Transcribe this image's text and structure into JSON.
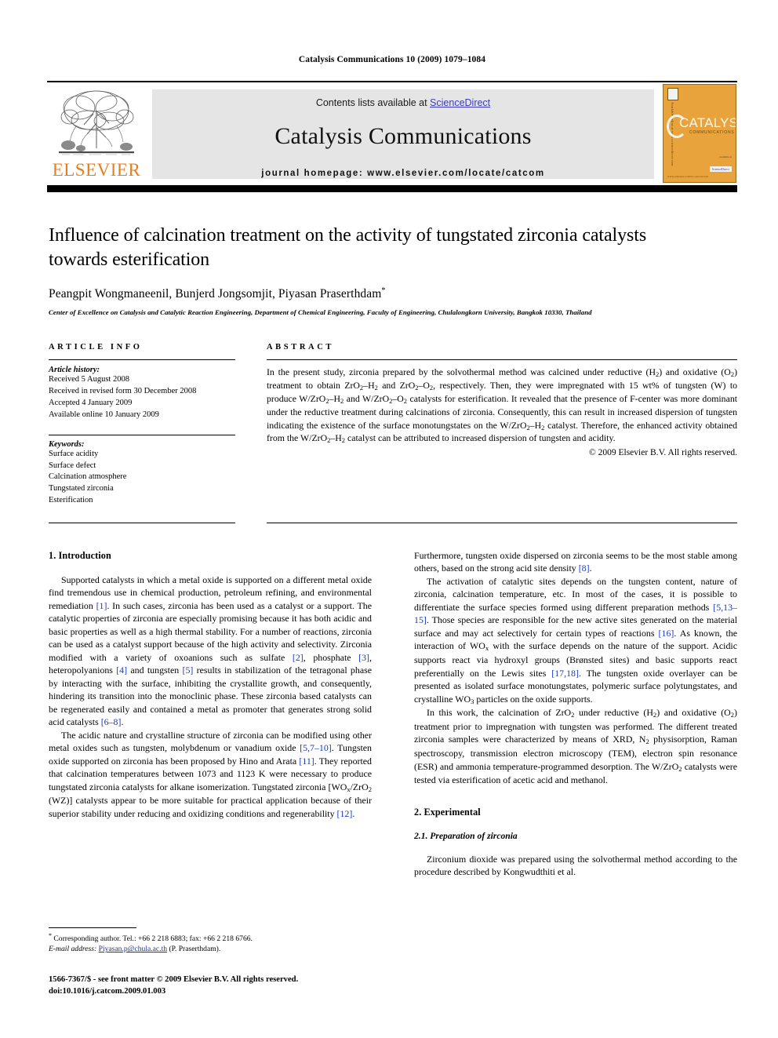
{
  "running_head": "Catalysis Communications 10 (2009) 1079–1084",
  "masthead": {
    "contents_prefix": "Contents lists available at ",
    "sciencedirect": "ScienceDirect",
    "journal_title": "Catalysis Communications",
    "homepage": "journal homepage: www.elsevier.com/locate/catcom",
    "publisher_wordmark": "ELSEVIER",
    "publisher_color": "#E87D1E",
    "link_color": "#3b3bbf",
    "panel_color": "#E5E5E5",
    "cover": {
      "title": "CATALYSIS",
      "subtitle": "COMMUNICATIONS",
      "bg_color": "#E8A33D",
      "vertical_text": "Available online at www.sciencedirect.com",
      "bottom_left": "www.elsevier.com/locate/catcom",
      "sd_above": "available at",
      "sd_badge": "ScienceDirect"
    }
  },
  "article": {
    "title": "Influence of calcination treatment on the activity of tungstated zirconia catalysts towards esterification",
    "authors": "Peangpit Wongmaneenil, Bunjerd Jongsomjit, Piyasan Praserthdam",
    "corresponding_marker": "*",
    "affiliation": "Center of Excellence on Catalysis and Catalytic Reaction Engineering, Department of Chemical Engineering, Faculty of Engineering, Chulalongkorn University, Bangkok 10330, Thailand"
  },
  "article_info": {
    "heading": "ARTICLE INFO",
    "history_label": "Article history:",
    "history": [
      "Received 5 August 2008",
      "Received in revised form 30 December 2008",
      "Accepted 4 January 2009",
      "Available online 10 January 2009"
    ],
    "keywords_label": "Keywords:",
    "keywords": [
      "Surface acidity",
      "Surface defect",
      "Calcination atmosphere",
      "Tungstated zirconia",
      "Esterification"
    ]
  },
  "abstract": {
    "heading": "ABSTRACT",
    "copyright": "© 2009 Elsevier B.V. All rights reserved."
  },
  "sections": {
    "introduction_heading": "1. Introduction",
    "experimental_heading": "2. Experimental",
    "prep_heading": "2.1. Preparation of zirconia"
  },
  "footnote": {
    "star": "*",
    "corresponding": "Corresponding author. Tel.: +66 2 218 6883; fax: +66 2 218 6766.",
    "email_label": "E-mail address:",
    "email": "Piyasan.p@chula.ac.th",
    "email_owner": "(P. Praserthdam).",
    "email_color": "#1a2fa0"
  },
  "imprint": {
    "line1": "1566-7367/$ - see front matter © 2009 Elsevier B.V. All rights reserved.",
    "line2": "doi:10.1016/j.catcom.2009.01.003"
  }
}
